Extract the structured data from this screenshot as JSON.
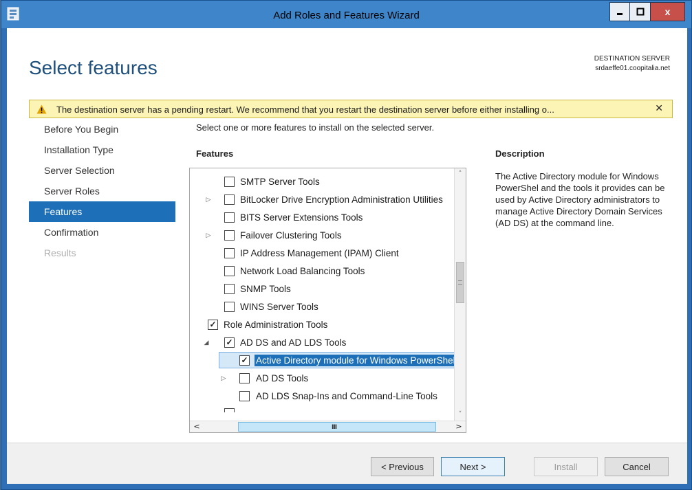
{
  "window": {
    "title": "Add Roles and Features Wizard",
    "min_label": "▁",
    "max_label": "□",
    "close_label": "x"
  },
  "header": {
    "page_title": "Select features",
    "destination_label": "DESTINATION SERVER",
    "destination_value": "srdaeffe01.coopitalia.net"
  },
  "warning": {
    "text": "The destination server has a pending restart. We recommend that you restart the destination server before either installing o...",
    "close": "✕"
  },
  "nav": {
    "items": [
      {
        "label": "Before You Begin",
        "state": "normal"
      },
      {
        "label": "Installation Type",
        "state": "normal"
      },
      {
        "label": "Server Selection",
        "state": "normal"
      },
      {
        "label": "Server Roles",
        "state": "normal"
      },
      {
        "label": "Features",
        "state": "active"
      },
      {
        "label": "Confirmation",
        "state": "normal"
      },
      {
        "label": "Results",
        "state": "disabled"
      }
    ]
  },
  "main": {
    "instruction": "Select one or more features to install on the selected server.",
    "features_label": "Features",
    "tree": [
      {
        "label": "SMTP Server Tools",
        "checked": false,
        "expander": ""
      },
      {
        "label": "BitLocker Drive Encryption Administration Utilities",
        "checked": false,
        "expander": "▷"
      },
      {
        "label": "BITS Server Extensions Tools",
        "checked": false,
        "expander": ""
      },
      {
        "label": "Failover Clustering Tools",
        "checked": false,
        "expander": "▷"
      },
      {
        "label": "IP Address Management (IPAM) Client",
        "checked": false,
        "expander": ""
      },
      {
        "label": "Network Load Balancing Tools",
        "checked": false,
        "expander": ""
      },
      {
        "label": "SNMP Tools",
        "checked": false,
        "expander": ""
      },
      {
        "label": "WINS Server Tools",
        "checked": false,
        "expander": ""
      },
      {
        "label": "Role Administration Tools",
        "checked": true,
        "expander": ""
      },
      {
        "label": "AD DS and AD LDS Tools",
        "checked": true,
        "expander": "◢"
      },
      {
        "label": "Active Directory module for Windows PowerShell",
        "checked": true,
        "expander": "",
        "selected": true
      },
      {
        "label": "AD DS Tools",
        "checked": false,
        "expander": "▷"
      },
      {
        "label": "AD LDS Snap-Ins and Command-Line Tools",
        "checked": false,
        "expander": ""
      }
    ],
    "check_mark": "✓"
  },
  "description": {
    "label": "Description",
    "text": "The Active Directory module for Windows PowerShel and the tools it provides can be used by Active Directory administrators to manage Active Directory Domain Services (AD DS) at the command line."
  },
  "footer": {
    "previous": "< Previous",
    "next": "Next >",
    "install": "Install",
    "cancel": "Cancel"
  },
  "scroll": {
    "up": "˄",
    "down": "˅",
    "left": "<",
    "right": ">",
    "grip": "III"
  },
  "colors": {
    "accent": "#1d70b7",
    "title": "#1f4f7b",
    "warning_bg": "#fcf4b5",
    "frame": "#3e85c9"
  }
}
